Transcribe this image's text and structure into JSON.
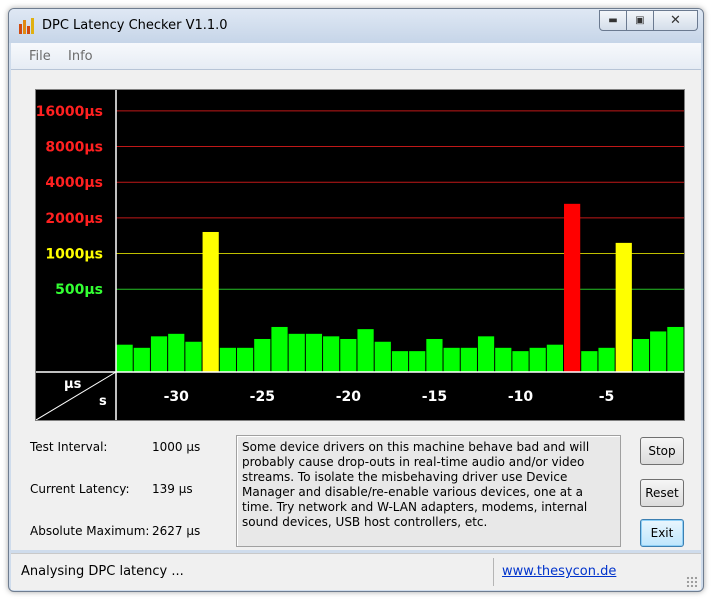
{
  "window": {
    "title": "DPC Latency Checker V1.1.0"
  },
  "caption": {
    "minimize": "minimize",
    "maximize": "maximize",
    "close": "close"
  },
  "menu": {
    "items": [
      "File",
      "Info"
    ]
  },
  "chart_data": {
    "type": "bar",
    "x": [
      -33,
      -32,
      -31,
      -30,
      -29,
      -28,
      -27,
      -26,
      -25,
      -24,
      -23,
      -22,
      -21,
      -20,
      -19,
      -18,
      -17,
      -16,
      -15,
      -14,
      -13,
      -12,
      -11,
      -10,
      -9,
      -8,
      -7,
      -6,
      -5,
      -4,
      -3,
      -2,
      -1
    ],
    "values": [
      170,
      160,
      200,
      210,
      180,
      1520,
      160,
      160,
      190,
      240,
      210,
      210,
      200,
      190,
      230,
      180,
      150,
      150,
      190,
      160,
      160,
      200,
      160,
      150,
      160,
      170,
      2627,
      150,
      160,
      1230,
      190,
      220,
      240
    ],
    "bar_colors": [
      "#00ff00",
      "#00ff00",
      "#00ff00",
      "#00ff00",
      "#00ff00",
      "#ffff00",
      "#00ff00",
      "#00ff00",
      "#00ff00",
      "#00ff00",
      "#00ff00",
      "#00ff00",
      "#00ff00",
      "#00ff00",
      "#00ff00",
      "#00ff00",
      "#00ff00",
      "#00ff00",
      "#00ff00",
      "#00ff00",
      "#00ff00",
      "#00ff00",
      "#00ff00",
      "#00ff00",
      "#00ff00",
      "#00ff00",
      "#ff0000",
      "#00ff00",
      "#00ff00",
      "#ffff00",
      "#00ff00",
      "#00ff00",
      "#00ff00"
    ],
    "y_ticks": [
      {
        "value": 500,
        "label": "500µs",
        "color": "#33ff33"
      },
      {
        "value": 1000,
        "label": "1000µs",
        "color": "#ffff00"
      },
      {
        "value": 2000,
        "label": "2000µs",
        "color": "#ff2020"
      },
      {
        "value": 4000,
        "label": "4000µs",
        "color": "#ff2020"
      },
      {
        "value": 8000,
        "label": "8000µs",
        "color": "#ff2020"
      },
      {
        "value": 16000,
        "label": "16000µs",
        "color": "#ff2020"
      }
    ],
    "x_ticks": [
      -30,
      -25,
      -20,
      -15,
      -10,
      -5
    ],
    "xlabel": "s",
    "ylabel": "µs",
    "yscale": "log2",
    "ylim": [
      100,
      24000
    ],
    "xlim": [
      -33.5,
      -0.5
    ],
    "background": "#000000"
  },
  "fields": {
    "test_interval_label": "Test Interval:",
    "test_interval_value": "1000 µs",
    "current_latency_label": "Current Latency:",
    "current_latency_value": "139 µs",
    "absolute_maximum_label": "Absolute Maximum:",
    "absolute_maximum_value": "2627 µs"
  },
  "info_text": "Some device drivers on this machine behave bad and will probably cause drop-outs in real-time audio and/or video streams. To isolate the misbehaving driver use Device Manager and disable/re-enable various devices, one at a time. Try network and W-LAN adapters, modems, internal sound devices, USB host controllers, etc.",
  "buttons": {
    "stop": "Stop",
    "reset": "Reset",
    "exit": "Exit"
  },
  "status": {
    "text": "Analysing DPC latency ...",
    "link": "www.thesycon.de"
  }
}
